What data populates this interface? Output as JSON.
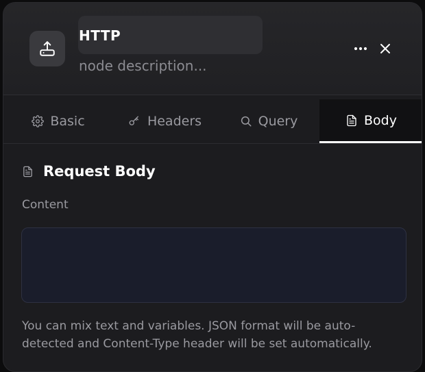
{
  "node": {
    "title": "HTTP",
    "description_placeholder": "node description...",
    "icon": "upload-icon"
  },
  "header_actions": {
    "more_icon": "more-icon",
    "close_icon": "close-icon"
  },
  "tabs": [
    {
      "label": "Basic",
      "icon": "gear-icon",
      "active": false
    },
    {
      "label": "Headers",
      "icon": "key-icon",
      "active": false
    },
    {
      "label": "Query",
      "icon": "search-icon",
      "active": false
    },
    {
      "label": "Body",
      "icon": "document-icon",
      "active": true
    }
  ],
  "body_section": {
    "title": "Request Body",
    "content_label": "Content",
    "content_value": "",
    "help_text": "You can mix text and variables. JSON format will be auto-detected and Content-Type header will be set automatically."
  },
  "colors": {
    "panel_bg": "#1c1c1f",
    "active_tab_bg": "#111113",
    "textarea_bg": "#1a1d2b"
  }
}
